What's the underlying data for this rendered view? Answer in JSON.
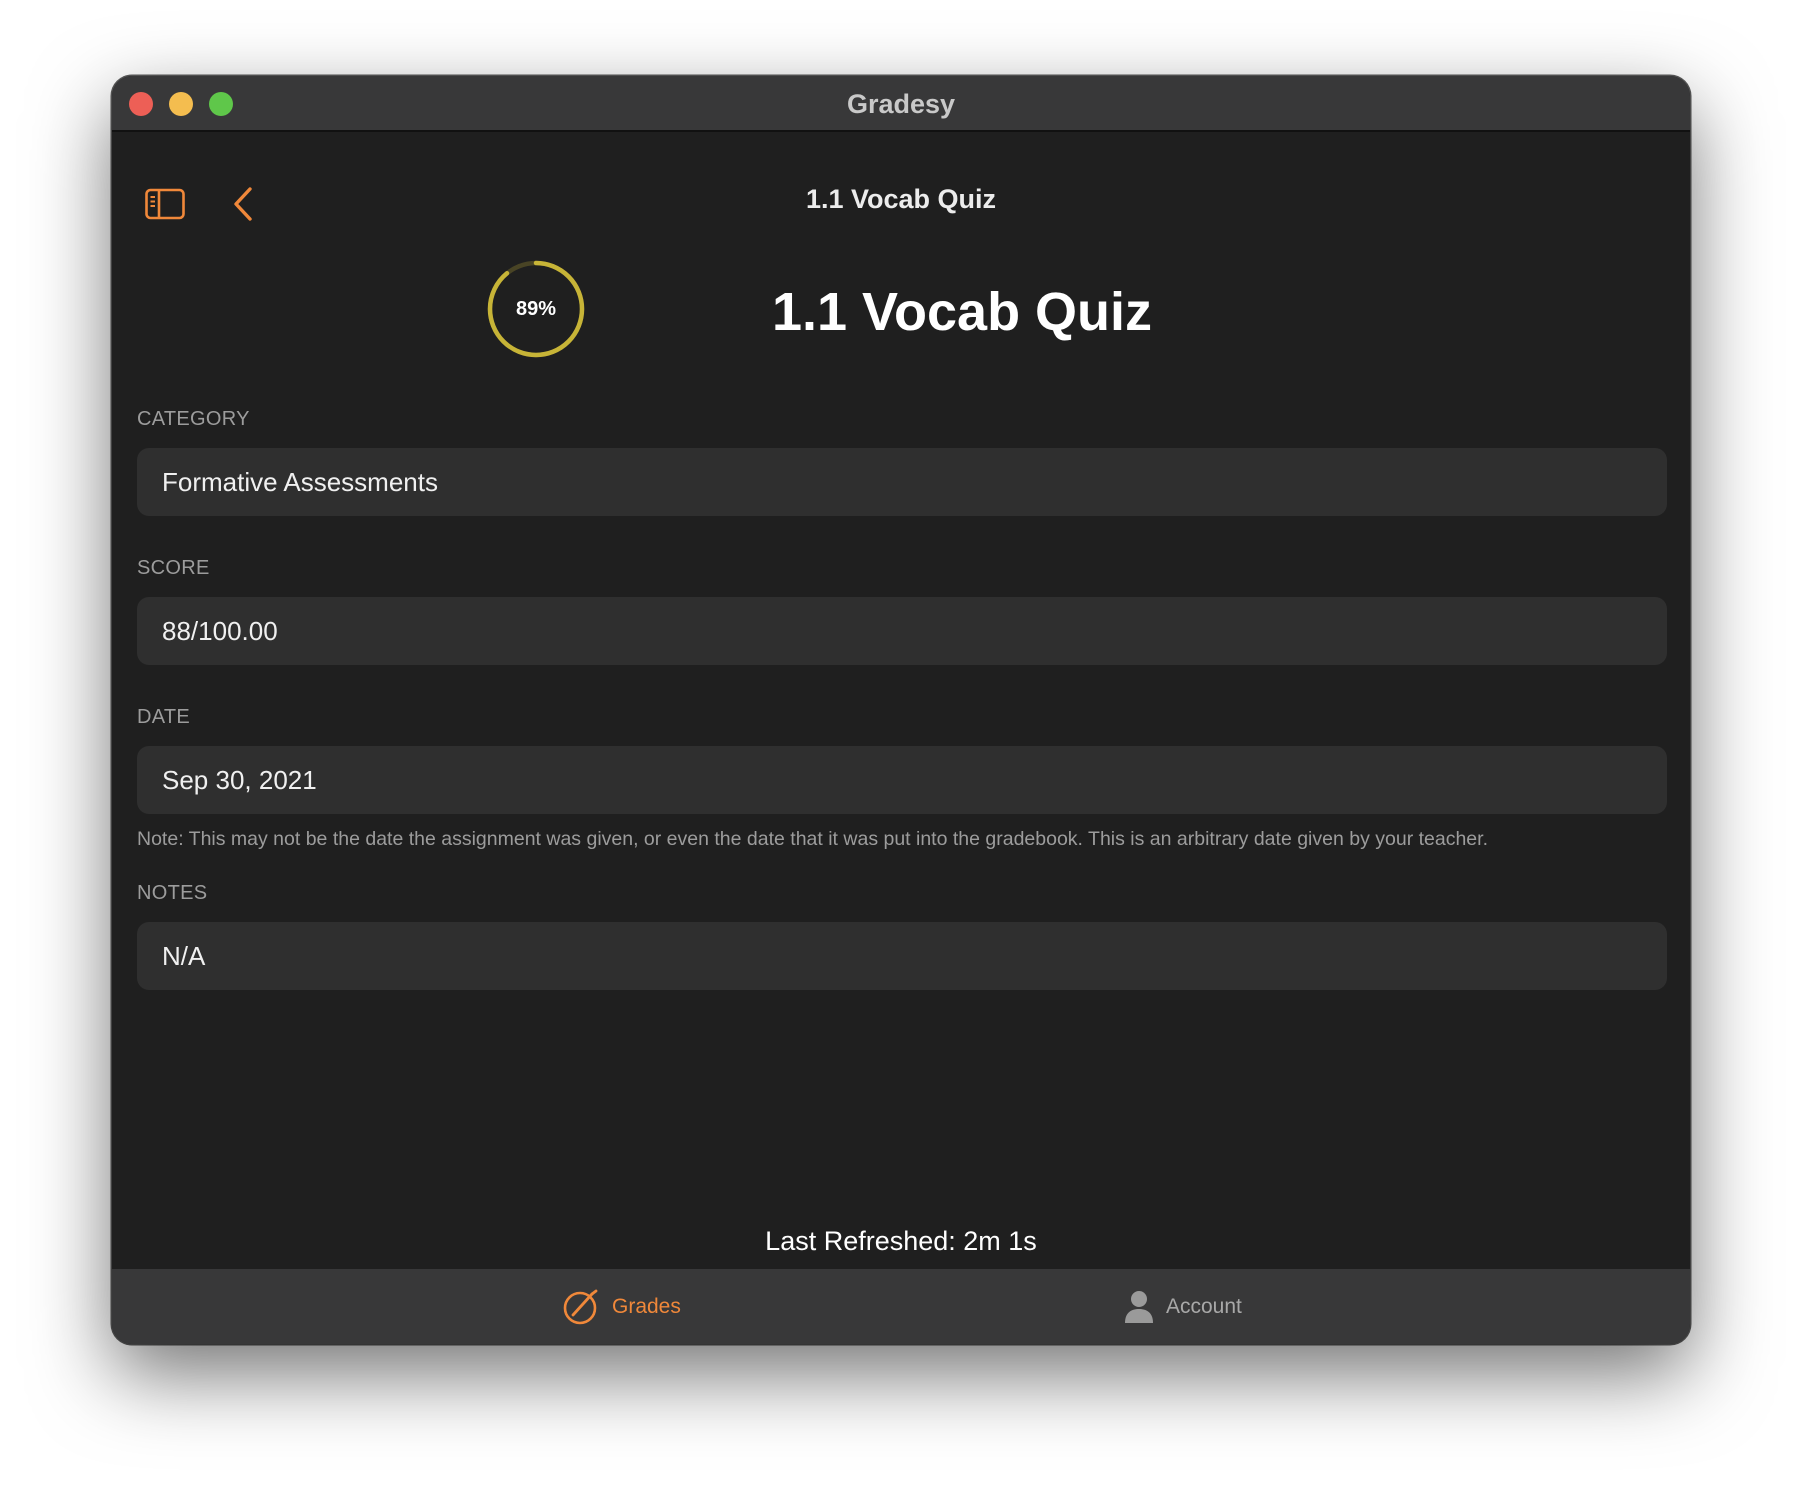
{
  "window": {
    "title": "Gradesy"
  },
  "nav": {
    "title": "1.1 Vocab Quiz",
    "sidebar_icon": "sidebar-toggle-icon",
    "back_icon": "chevron-left-icon"
  },
  "assignment": {
    "title": "1.1 Vocab Quiz",
    "percent_label": "89%",
    "percent_value": 0.89
  },
  "sections": {
    "category": {
      "label": "CATEGORY",
      "value": "Formative Assessments"
    },
    "score": {
      "label": "SCORE",
      "value": "88/100.00"
    },
    "date": {
      "label": "DATE",
      "value": "Sep 30, 2021",
      "note": "Note: This may not be the date the assignment was given, or even the date that it was put into the gradebook. This is an arbitrary date given by your teacher."
    },
    "notes": {
      "label": "NOTES",
      "value": "N/A"
    }
  },
  "footer": {
    "refresh": "Last Refreshed: 2m 1s"
  },
  "tabs": [
    {
      "label": "Grades",
      "icon": "grades-icon",
      "selected": true
    },
    {
      "label": "Account",
      "icon": "person-icon",
      "selected": false
    }
  ],
  "colors": {
    "accent": "#f0883a",
    "ring": "#c7b437",
    "background": "#1f1f1f",
    "field": "#2f2f2f",
    "titlebar": "#383839"
  }
}
